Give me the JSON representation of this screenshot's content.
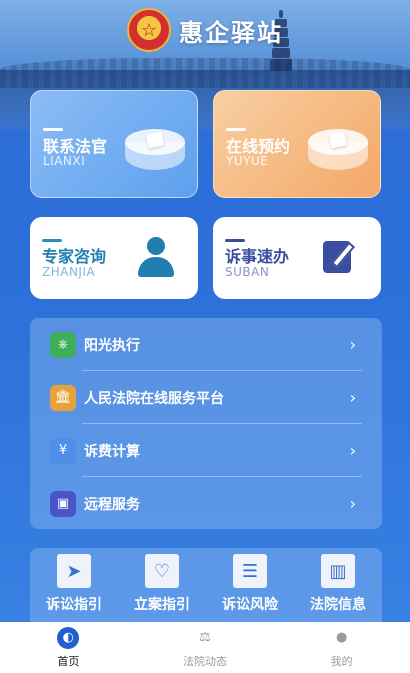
{
  "header": {
    "title": "惠企驿站",
    "emblem_icon": "court-emblem-icon"
  },
  "cards": {
    "lianxi": {
      "title": "联系法官",
      "subtitle": "LIANXI"
    },
    "yuyue": {
      "title": "在线预约",
      "subtitle": "YUYUE"
    },
    "zhanjia": {
      "title": "专家咨询",
      "subtitle": "ZHANJIA"
    },
    "suban": {
      "title": "诉事速办",
      "subtitle": "SUBAN"
    }
  },
  "services": [
    {
      "label": "阳光执行",
      "icon": "stamp-icon",
      "color": "#3fae5b"
    },
    {
      "label": "人民法院在线服务平台",
      "icon": "courthouse-icon",
      "color": "#e9a23b"
    },
    {
      "label": "诉费计算",
      "icon": "yen-icon",
      "color": "#4f8fe8"
    },
    {
      "label": "远程服务",
      "icon": "monitor-icon",
      "color": "#4a54c9"
    }
  ],
  "quick": [
    {
      "label": "诉讼指引",
      "icon": "navigation-icon"
    },
    {
      "label": "立案指引",
      "icon": "hand-heart-icon"
    },
    {
      "label": "诉讼风险",
      "icon": "document-icon"
    },
    {
      "label": "法院信息",
      "icon": "building-icon"
    }
  ],
  "tabs": [
    {
      "label": "首页",
      "icon": "home-icon",
      "active": true
    },
    {
      "label": "法院动态",
      "icon": "scales-icon",
      "active": false
    },
    {
      "label": "我的",
      "icon": "user-icon",
      "active": false
    }
  ],
  "colors": {
    "primary": "#2f6fd6",
    "active_tab": "#1a1a1a",
    "inactive_tab": "#9a9a9a"
  }
}
